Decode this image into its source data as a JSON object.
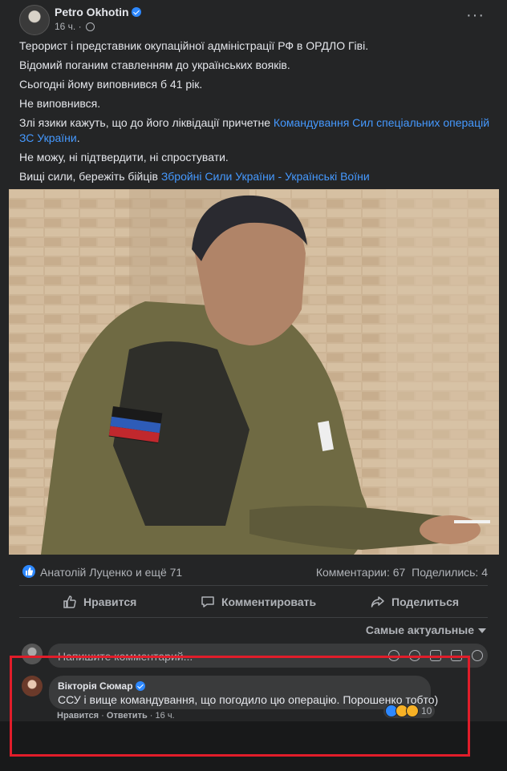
{
  "post": {
    "author": "Petro Okhotin",
    "time": "16 ч.",
    "paragraphs": [
      {
        "text": "Терорист і представник окупаційної адміністрації РФ в ОРДЛО Гіві.",
        "link": ""
      },
      {
        "text": "Відомий поганим ставленням до українських вояків.",
        "link": ""
      },
      {
        "text": "Сьогодні йому виповнився б 41 рік.",
        "link": ""
      },
      {
        "text": "Не виповнився.",
        "link": ""
      }
    ],
    "p5_text": "Злі язики кажуть, що до його ліквідації причетне ",
    "p5_link": "Командування Сил спеціальних операцій ЗС України",
    "p5_end": ".",
    "p6_text": "Не можу, ні підтвердити, ні спростувати.",
    "p7_text": "Вищі сили, бережіть бійців ",
    "p7_link": "Збройні Сили України - Українські Воїни"
  },
  "stats": {
    "reactors": "Анатолій Луценко и ещё 71",
    "comments": "Комментарии: 67",
    "shares": "Поделились: 4"
  },
  "actions": {
    "like": "Нравится",
    "comment": "Комментировать",
    "share": "Поделиться"
  },
  "sort_label": "Самые актуальные",
  "composer_placeholder": "Напишите комментарий...",
  "comment": {
    "author": "Вікторія Сюмар",
    "text": "ССУ і вище командування, що погодило цю операцію. Порошенко тобто)",
    "reaction_count": "10",
    "like": "Нравится",
    "reply": "Ответить",
    "sep": "·",
    "time": "16 ч."
  },
  "colors": {
    "background": "#18191a",
    "card": "#242526",
    "link": "#4599ff",
    "accent_blue": "#2d88ff",
    "highlight": "#e11d2a"
  }
}
